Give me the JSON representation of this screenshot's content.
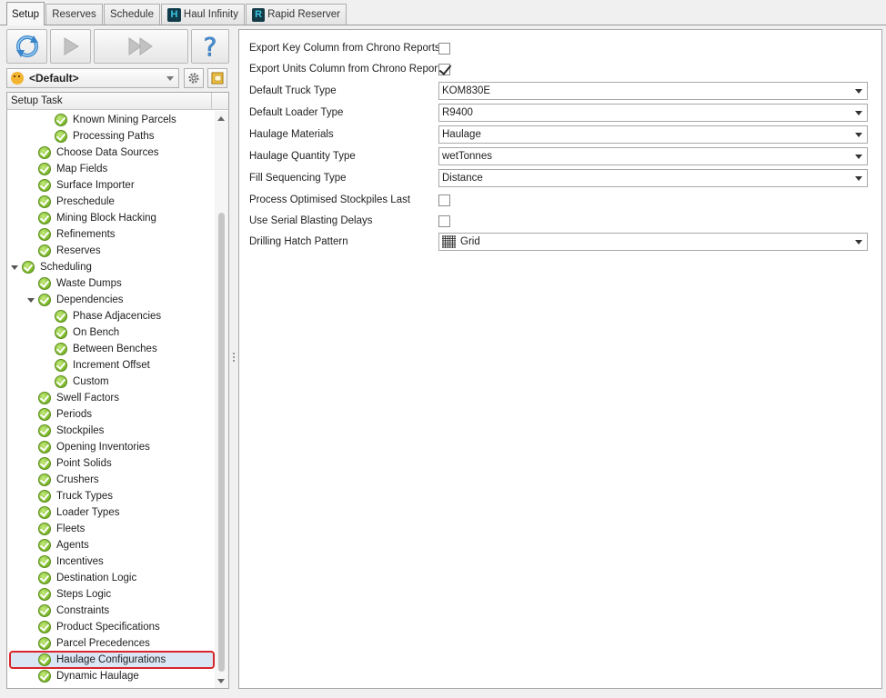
{
  "tabs": [
    {
      "label": "Setup",
      "active": true
    },
    {
      "label": "Reserves",
      "active": false
    },
    {
      "label": "Schedule",
      "active": false
    },
    {
      "label": "Haul Infinity",
      "active": false,
      "icon": "haul-infinity-app-icon"
    },
    {
      "label": "Rapid Reserver",
      "active": false,
      "icon": "rapid-reserver-app-icon"
    }
  ],
  "toolbar": {
    "icons": [
      "refresh-icon",
      "play-icon",
      "fast-forward-icon",
      "help-icon"
    ]
  },
  "profile": {
    "selected": "<Default>",
    "icon": "mask-icon"
  },
  "tree": {
    "header": "Setup Task",
    "items": [
      {
        "label": "Known Mining Parcels",
        "level": 2
      },
      {
        "label": "Processing Paths",
        "level": 2
      },
      {
        "label": "Choose Data Sources",
        "level": 1
      },
      {
        "label": "Map Fields",
        "level": 1
      },
      {
        "label": "Surface Importer",
        "level": 1
      },
      {
        "label": "Preschedule",
        "level": 1
      },
      {
        "label": "Mining Block Hacking",
        "level": 1
      },
      {
        "label": "Refinements",
        "level": 1
      },
      {
        "label": "Reserves",
        "level": 1
      },
      {
        "label": "Scheduling",
        "level": 0,
        "expanded": true
      },
      {
        "label": "Waste Dumps",
        "level": 1
      },
      {
        "label": "Dependencies",
        "level": 1,
        "expanded": true
      },
      {
        "label": "Phase Adjacencies",
        "level": 2
      },
      {
        "label": "On Bench",
        "level": 2
      },
      {
        "label": "Between Benches",
        "level": 2
      },
      {
        "label": "Increment Offset",
        "level": 2
      },
      {
        "label": "Custom",
        "level": 2
      },
      {
        "label": "Swell Factors",
        "level": 1
      },
      {
        "label": "Periods",
        "level": 1
      },
      {
        "label": "Stockpiles",
        "level": 1
      },
      {
        "label": "Opening Inventories",
        "level": 1
      },
      {
        "label": "Point Solids",
        "level": 1
      },
      {
        "label": "Crushers",
        "level": 1
      },
      {
        "label": "Truck Types",
        "level": 1
      },
      {
        "label": "Loader Types",
        "level": 1
      },
      {
        "label": "Fleets",
        "level": 1
      },
      {
        "label": "Agents",
        "level": 1
      },
      {
        "label": "Incentives",
        "level": 1
      },
      {
        "label": "Destination Logic",
        "level": 1
      },
      {
        "label": "Steps Logic",
        "level": 1
      },
      {
        "label": "Constraints",
        "level": 1
      },
      {
        "label": "Product Specifications",
        "level": 1
      },
      {
        "label": "Parcel Precedences",
        "level": 1
      },
      {
        "label": "Haulage Configurations",
        "level": 1,
        "selected": true
      },
      {
        "label": "Dynamic Haulage",
        "level": 1
      }
    ]
  },
  "properties": [
    {
      "label": "Export Key Column from Chrono Reports",
      "type": "checkbox",
      "checked": false
    },
    {
      "label": "Export Units Column from Chrono Reports",
      "type": "checkbox",
      "checked": true
    },
    {
      "label": "Default Truck Type",
      "type": "dropdown",
      "value": "KOM830E"
    },
    {
      "label": "Default Loader Type",
      "type": "dropdown",
      "value": "R9400"
    },
    {
      "label": "Haulage Materials",
      "type": "dropdown",
      "value": "Haulage"
    },
    {
      "label": "Haulage Quantity Type",
      "type": "dropdown",
      "value": "wetTonnes"
    },
    {
      "label": "Fill Sequencing Type",
      "type": "dropdown",
      "value": "Distance"
    },
    {
      "label": "Process Optimised Stockpiles Last",
      "type": "checkbox",
      "checked": false
    },
    {
      "label": "Use Serial Blasting Delays",
      "type": "checkbox",
      "checked": false
    },
    {
      "label": "Drilling Hatch Pattern",
      "type": "dropdown",
      "value": "Grid",
      "icon": "grid-pattern-icon"
    }
  ],
  "colors": {
    "selection_outline": "#d9252b",
    "selection_fill": "#dbe6f4",
    "check_green": "#79b628"
  }
}
